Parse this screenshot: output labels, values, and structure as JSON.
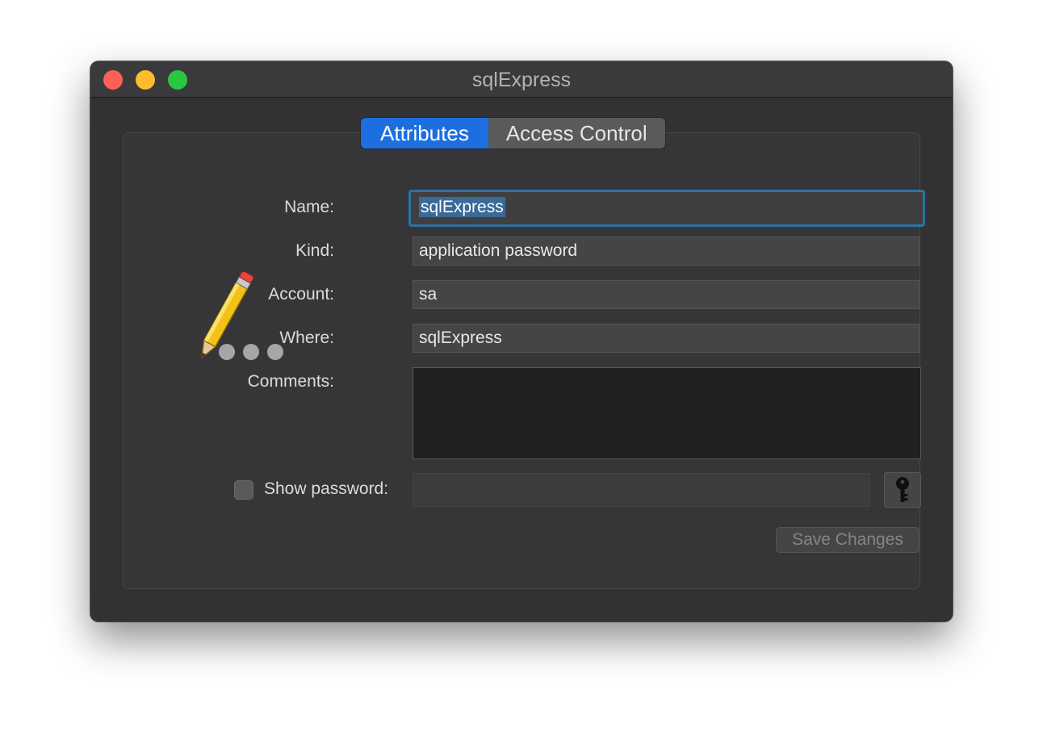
{
  "window": {
    "title": "sqlExpress"
  },
  "tabs": [
    {
      "label": "Attributes",
      "active": true
    },
    {
      "label": "Access Control",
      "active": false
    }
  ],
  "form": {
    "name_label": "Name:",
    "name_value": "sqlExpress",
    "kind_label": "Kind:",
    "kind_value": "application password",
    "account_label": "Account:",
    "account_value": "sa",
    "where_label": "Where:",
    "where_value": "sqlExpress",
    "comments_label": "Comments:",
    "comments_value": "",
    "show_password_label": "Show password:",
    "show_password_checked": false,
    "password_value": ""
  },
  "buttons": {
    "save_label": "Save Changes"
  },
  "icons": {
    "app_icon": "pencil-password-icon",
    "key_icon": "key-icon"
  },
  "colors": {
    "accent": "#1d6fe0",
    "focus_ring": "#2c73a1",
    "close": "#fe5f57",
    "minimize": "#febc2e",
    "zoom": "#28c840"
  }
}
